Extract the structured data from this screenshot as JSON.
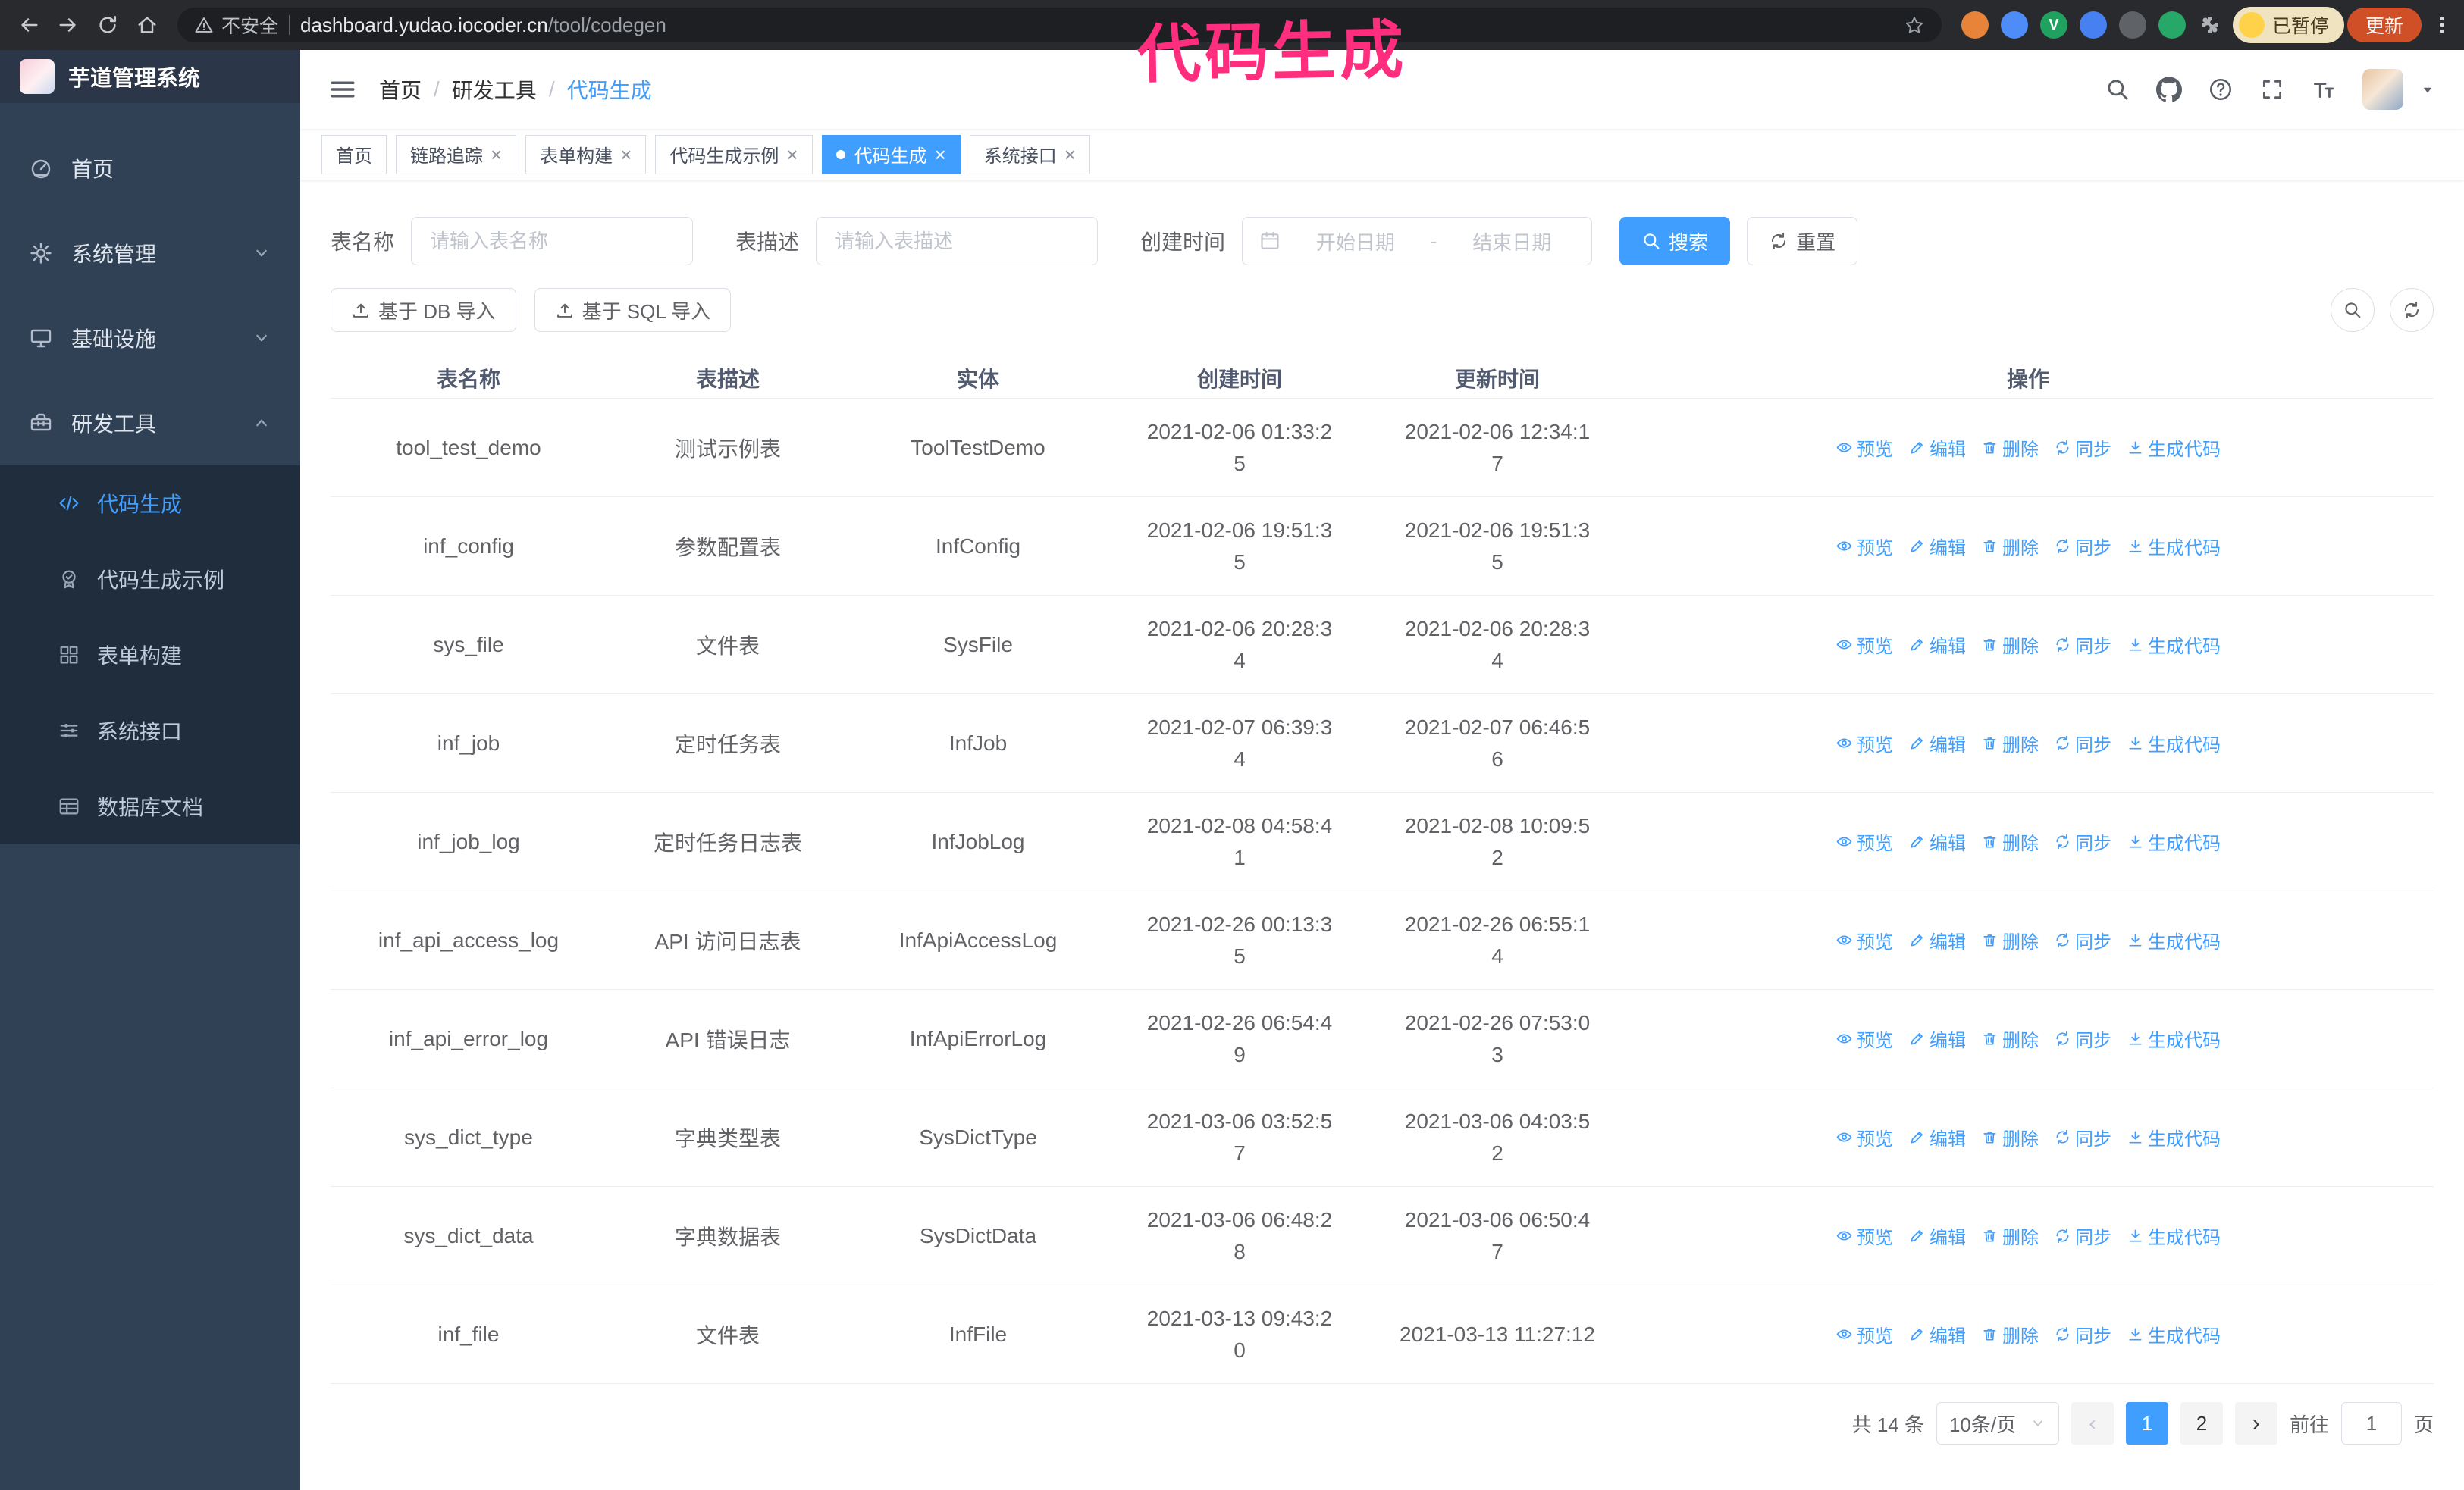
{
  "browser": {
    "security_label": "不安全",
    "url_host": "dashboard.yudao.iocoder.cn",
    "url_path": "/tool/codegen",
    "profile_chip_label": "已暂停",
    "update_button_label": "更新"
  },
  "annotation": {
    "text": "代码生成",
    "color": "#ff2d7d"
  },
  "sidebar": {
    "logo_title": "芋道管理系统",
    "items": [
      {
        "label": "首页"
      },
      {
        "label": "系统管理"
      },
      {
        "label": "基础设施"
      },
      {
        "label": "研发工具"
      }
    ],
    "sub_items": [
      {
        "label": "代码生成"
      },
      {
        "label": "代码生成示例"
      },
      {
        "label": "表单构建"
      },
      {
        "label": "系统接口"
      },
      {
        "label": "数据库文档"
      }
    ]
  },
  "breadcrumb": {
    "separator": "/",
    "items": [
      "首页",
      "研发工具",
      "代码生成"
    ]
  },
  "tabs": [
    {
      "label": "首页"
    },
    {
      "label": "链路追踪"
    },
    {
      "label": "表单构建"
    },
    {
      "label": "代码生成示例"
    },
    {
      "label": "代码生成"
    },
    {
      "label": "系统接口"
    }
  ],
  "filters": {
    "table_name_label": "表名称",
    "table_name_placeholder": "请输入表名称",
    "table_desc_label": "表描述",
    "table_desc_placeholder": "请输入表描述",
    "create_time_label": "创建时间",
    "date_start_placeholder": "开始日期",
    "date_separator": "-",
    "date_end_placeholder": "结束日期",
    "search_button_label": "搜索",
    "reset_button_label": "重置"
  },
  "toolbar": {
    "import_db_label": "基于 DB 导入",
    "import_sql_label": "基于 SQL 导入"
  },
  "table": {
    "columns": [
      "表名称",
      "表描述",
      "实体",
      "创建时间",
      "更新时间",
      "操作"
    ],
    "action_labels": [
      "预览",
      "编辑",
      "删除",
      "同步",
      "生成代码"
    ],
    "rows": [
      {
        "name": "tool_test_demo",
        "desc": "测试示例表",
        "entity": "ToolTestDemo",
        "created": "2021-02-06 01:33:25",
        "updated": "2021-02-06 12:34:17"
      },
      {
        "name": "inf_config",
        "desc": "参数配置表",
        "entity": "InfConfig",
        "created": "2021-02-06 19:51:35",
        "updated": "2021-02-06 19:51:35"
      },
      {
        "name": "sys_file",
        "desc": "文件表",
        "entity": "SysFile",
        "created": "2021-02-06 20:28:34",
        "updated": "2021-02-06 20:28:34"
      },
      {
        "name": "inf_job",
        "desc": "定时任务表",
        "entity": "InfJob",
        "created": "2021-02-07 06:39:34",
        "updated": "2021-02-07 06:46:56"
      },
      {
        "name": "inf_job_log",
        "desc": "定时任务日志表",
        "entity": "InfJobLog",
        "created": "2021-02-08 04:58:41",
        "updated": "2021-02-08 10:09:52"
      },
      {
        "name": "inf_api_access_log",
        "desc": "API 访问日志表",
        "entity": "InfApiAccessLog",
        "created": "2021-02-26 00:13:35",
        "updated": "2021-02-26 06:55:14"
      },
      {
        "name": "inf_api_error_log",
        "desc": "API 错误日志",
        "entity": "InfApiErrorLog",
        "created": "2021-02-26 06:54:49",
        "updated": "2021-02-26 07:53:03"
      },
      {
        "name": "sys_dict_type",
        "desc": "字典类型表",
        "entity": "SysDictType",
        "created": "2021-03-06 03:52:57",
        "updated": "2021-03-06 04:03:52"
      },
      {
        "name": "sys_dict_data",
        "desc": "字典数据表",
        "entity": "SysDictData",
        "created": "2021-03-06 06:48:28",
        "updated": "2021-03-06 06:50:47"
      },
      {
        "name": "inf_file",
        "desc": "文件表",
        "entity": "InfFile",
        "created": "2021-03-13 09:43:20",
        "updated": "2021-03-13 11:27:12"
      }
    ]
  },
  "pagination": {
    "total_text": "共 14 条",
    "page_size_text": "10条/页",
    "pages": [
      "1",
      "2"
    ],
    "active_page": "1",
    "goto_prefix": "前往",
    "goto_value": "1",
    "goto_suffix": "页"
  },
  "icons": {
    "close": "×",
    "pager_prev": "‹",
    "pager_next": "›"
  },
  "colors": {
    "primary": "#409eff",
    "sidebar_bg": "#304156",
    "submenu_bg": "#1f2d3d",
    "annotation": "#ff2d7d",
    "update_chip": "#d14f26",
    "browser_bar": "#282a2d"
  }
}
